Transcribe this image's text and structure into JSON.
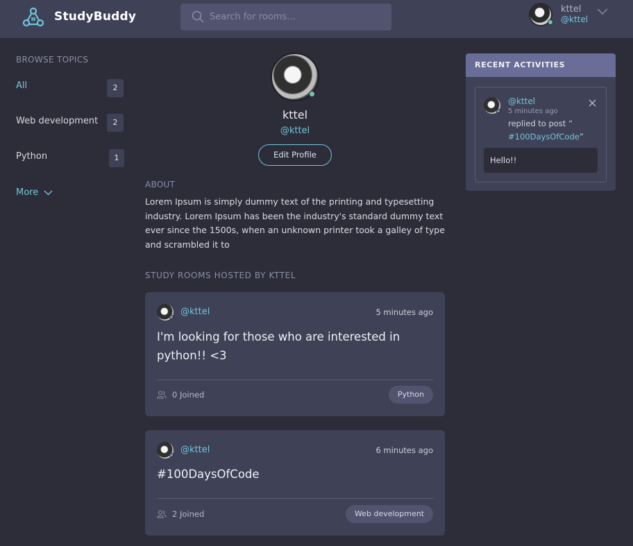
{
  "header": {
    "brand": "StudyBuddy",
    "search_placeholder": "Search for rooms...",
    "user_name": "kttel",
    "user_handle": "@kttel"
  },
  "sidebar": {
    "title": "BROWSE TOPICS",
    "topics": [
      {
        "label": "All",
        "count": "2"
      },
      {
        "label": "Web development",
        "count": "2"
      },
      {
        "label": "Python",
        "count": "1"
      }
    ],
    "more_label": "More"
  },
  "profile": {
    "name": "kttel",
    "handle": "@kttel",
    "edit_label": "Edit Profile",
    "about_title": "ABOUT",
    "about_text": "Lorem Ipsum is simply dummy text of the printing and typesetting industry. Lorem Ipsum has been the industry's standard dummy text ever since the 1500s, when an unknown printer took a galley of type and scrambled it to",
    "rooms_title": "STUDY ROOMS HOSTED BY KTTEL"
  },
  "rooms": [
    {
      "handle": "@kttel",
      "time": "5 minutes ago",
      "title": "I'm looking for those who are interested in python!! <3",
      "joined": "0 Joined",
      "topic": "Python"
    },
    {
      "handle": "@kttel",
      "time": "6 minutes ago",
      "title": "#100DaysOfCode",
      "joined": "2 Joined",
      "topic": "Web development"
    }
  ],
  "activities": {
    "title": "RECENT ACTIVITIES",
    "item": {
      "handle": "@kttel",
      "time": "5 minutes ago",
      "action": "replied to post “",
      "post": "#100DaysOfCode",
      "post_close": "”",
      "reply": "Hello!!"
    }
  },
  "colors": {
    "accent": "#71c6dd",
    "background": "#2d2d39",
    "panel": "#3f4156",
    "online": "#71c6a9"
  }
}
